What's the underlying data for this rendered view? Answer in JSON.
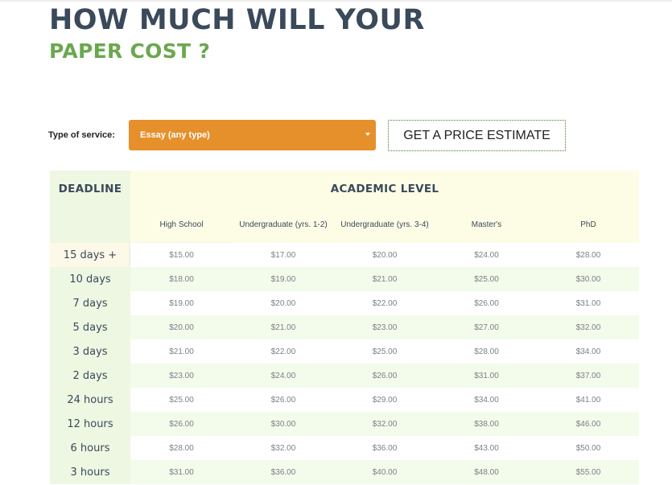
{
  "heading": {
    "line1": "HOW MUCH WILL YOUR",
    "line2": "PAPER COST ?"
  },
  "service": {
    "label": "Type of service:",
    "selected": "Essay (any type)",
    "icon": "caret-down-icon"
  },
  "estimate_button": {
    "label": "GET A PRICE ESTIMATE"
  },
  "table": {
    "deadline_header": "DEADLINE",
    "academic_header": "ACADEMIC LEVEL",
    "levels": [
      "High School",
      "Undergraduate (yrs. 1-2)",
      "Undergraduate (yrs. 3-4)",
      "Master's",
      "PhD"
    ],
    "rows": [
      {
        "deadline": "15 days +",
        "prices": [
          "$15.00",
          "$17.00",
          "$20.00",
          "$24.00",
          "$28.00"
        ]
      },
      {
        "deadline": "10 days",
        "prices": [
          "$18.00",
          "$19.00",
          "$21.00",
          "$25.00",
          "$30.00"
        ]
      },
      {
        "deadline": "7 days",
        "prices": [
          "$19.00",
          "$20.00",
          "$22.00",
          "$26.00",
          "$31.00"
        ]
      },
      {
        "deadline": "5 days",
        "prices": [
          "$20.00",
          "$21.00",
          "$23.00",
          "$27.00",
          "$32.00"
        ]
      },
      {
        "deadline": "3 days",
        "prices": [
          "$21.00",
          "$22.00",
          "$25.00",
          "$28.00",
          "$34.00"
        ]
      },
      {
        "deadline": "2 days",
        "prices": [
          "$23.00",
          "$24.00",
          "$26.00",
          "$31.00",
          "$37.00"
        ]
      },
      {
        "deadline": "24 hours",
        "prices": [
          "$25.00",
          "$26.00",
          "$29.00",
          "$34.00",
          "$41.00"
        ]
      },
      {
        "deadline": "12 hours",
        "prices": [
          "$26.00",
          "$30.00",
          "$32.00",
          "$38.00",
          "$46.00"
        ]
      },
      {
        "deadline": "6 hours",
        "prices": [
          "$28.00",
          "$32.00",
          "$36.00",
          "$43.00",
          "$50.00"
        ]
      },
      {
        "deadline": "3 hours",
        "prices": [
          "$31.00",
          "$36.00",
          "$40.00",
          "$48.00",
          "$55.00"
        ]
      }
    ]
  },
  "colors": {
    "heading_dark": "#3a4a5a",
    "heading_green": "#6aa84f",
    "select_orange": "#e6902b",
    "row_green": "#f3fbea",
    "header_cream": "#fdfde6"
  }
}
